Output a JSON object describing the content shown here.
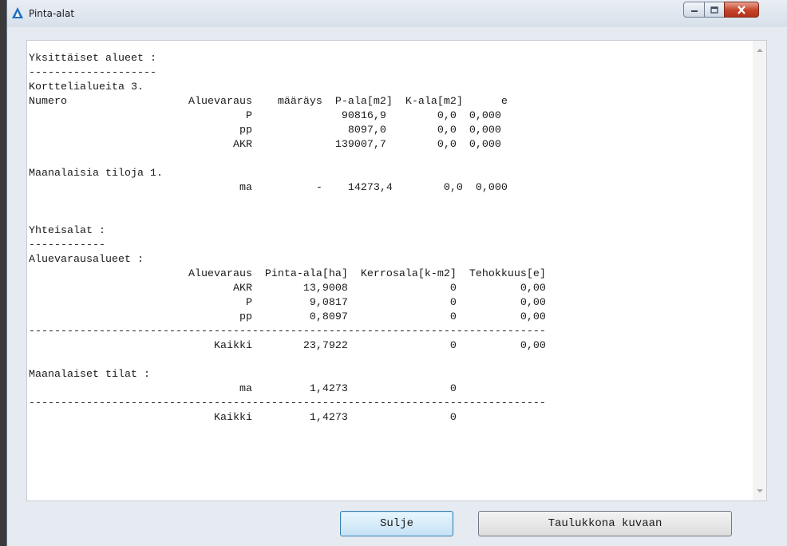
{
  "window": {
    "title": "Pinta-alat"
  },
  "icons": {
    "app": "autocad-triangle-icon",
    "minimize": "minimize-icon",
    "maximize": "maximize-icon",
    "close": "close-icon"
  },
  "report_lines": [
    "Yksittäiset alueet :",
    "--------------------",
    "Korttelialueita 3.",
    "Numero                   Aluevaraus    määräys  P-ala[m2]  K-ala[m2]      e",
    "                                  P              90816,9        0,0  0,000",
    "                                 pp               8097,0        0,0  0,000",
    "                                AKR             139007,7        0,0  0,000",
    "",
    "Maanalaisia tiloja 1.",
    "                                 ma          -    14273,4        0,0  0,000",
    "",
    "",
    "Yhteisalat :",
    "------------",
    "Aluevarausalueet :",
    "                         Aluevaraus  Pinta-ala[ha]  Kerrosala[k-m2]  Tehokkuus[e]",
    "                                AKR        13,9008                0          0,00",
    "                                  P         9,0817                0          0,00",
    "                                 pp         0,8097                0          0,00",
    "---------------------------------------------------------------------------------",
    "                             Kaikki        23,7922                0          0,00",
    "",
    "Maanalaiset tilat :",
    "                                 ma         1,4273                0",
    "---------------------------------------------------------------------------------",
    "                             Kaikki         1,4273                0"
  ],
  "buttons": {
    "close_label": "Sulje",
    "table_label": "Taulukkona kuvaan"
  },
  "colors": {
    "accent": "#3c7fb1",
    "close_button": "#c4432a"
  }
}
